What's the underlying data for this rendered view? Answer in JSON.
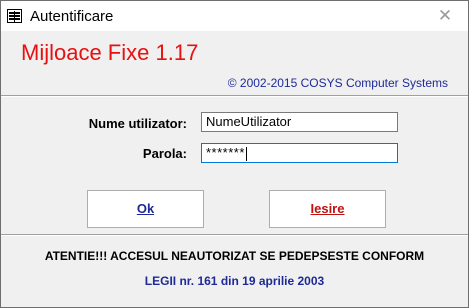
{
  "window": {
    "title": "Autentificare",
    "close_symbol": "✕",
    "icon": "form-icon"
  },
  "header": {
    "app_title": "Mijloace Fixe 1.17",
    "copyright": "© 2002-2015 COSYS Computer Systems"
  },
  "form": {
    "username_label": "Nume utilizator:",
    "username_value": "NumeUtilizator",
    "password_label": "Parola:",
    "password_value": "*******"
  },
  "buttons": {
    "ok_label": "Ok",
    "exit_label": "Iesire"
  },
  "footer": {
    "warning": "ATENTIE!!! ACCESUL NEAUTORIZAT SE PEDEPSESTE CONFORM",
    "law": "LEGII nr. 161 din 19 aprilie 2003"
  },
  "colors": {
    "title_red": "#e81010",
    "text_blue": "#1e2a96",
    "exit_red": "#c01010",
    "dialog_bg": "#f0f0f0"
  }
}
